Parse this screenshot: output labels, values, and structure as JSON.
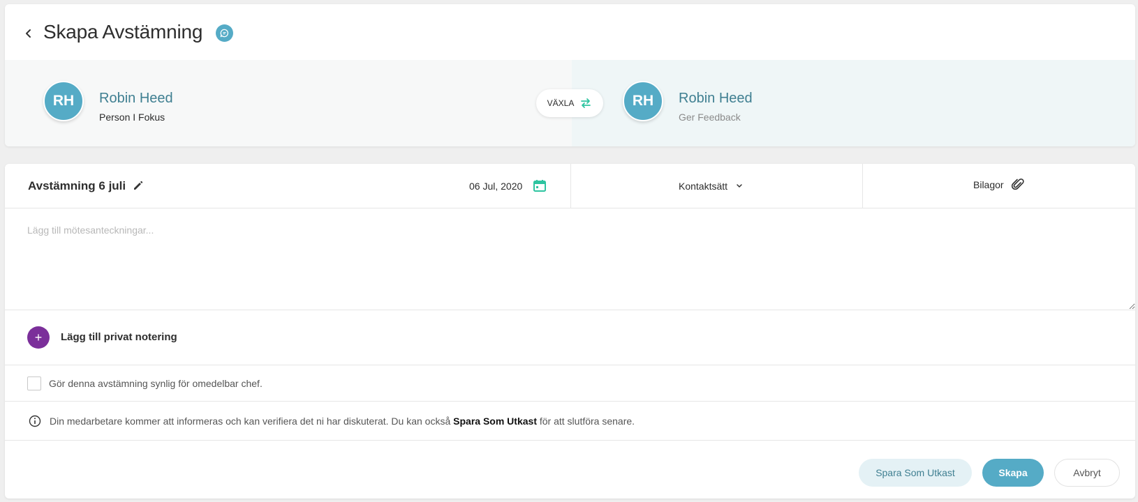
{
  "header": {
    "title": "Skapa Avstämning"
  },
  "persons": {
    "left": {
      "initials": "RH",
      "name": "Robin Heed",
      "role": "Person I Fokus"
    },
    "right": {
      "initials": "RH",
      "name": "Robin Heed",
      "role": "Ger Feedback"
    },
    "switch_label": "VÄXLA"
  },
  "checkin": {
    "title": "Avstämning 6 juli",
    "date": "06 Jul, 2020",
    "contact_label": "Kontaktsätt",
    "attachments_label": "Bilagor",
    "notes_placeholder": "Lägg till mötesanteckningar...",
    "private_note_label": "Lägg till privat notering",
    "visibility_label": "Gör denna avstämning synlig för omedelbar chef.",
    "info_prefix": "Din medarbetare kommer att informeras och kan verifiera det ni har diskuterat. Du kan också ",
    "info_bold": "Spara Som Utkast",
    "info_suffix": " för att slutföra senare."
  },
  "actions": {
    "draft": "Spara Som Utkast",
    "create": "Skapa",
    "cancel": "Avbryt"
  },
  "colors": {
    "accent": "#55abc6",
    "calendar": "#2ec4a0",
    "plus": "#7b2f9a",
    "name_text": "#3f7f91"
  }
}
